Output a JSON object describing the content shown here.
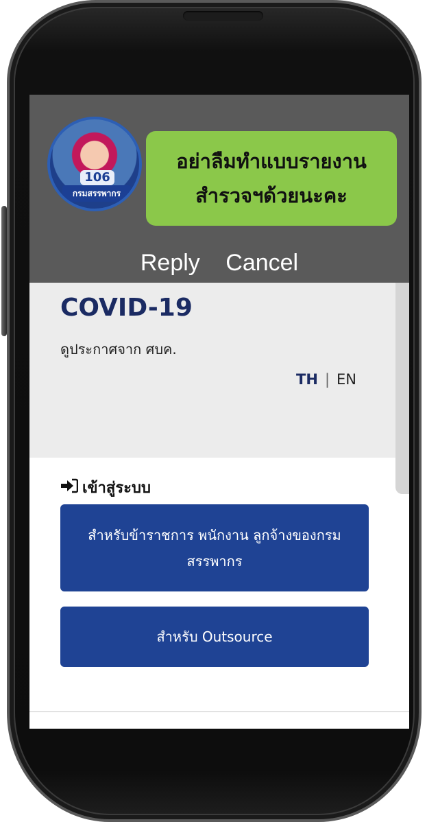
{
  "notification": {
    "message_line1": "อย่าลืมทำแบบรายงาน",
    "message_line2": "สำรวจฯด้วยนะคะ",
    "avatar_badge": "กรมสรรพากร",
    "avatar_number": "106",
    "reply_label": "Reply",
    "cancel_label": "Cancel",
    "bubble_color": "#8bc84a"
  },
  "hero": {
    "title": "COVID-19",
    "subtitle": "ดูประกาศจาก ศบค.",
    "lang_th": "TH",
    "lang_separator": "|",
    "lang_en": "EN"
  },
  "login": {
    "heading": "เข้าสู่ระบบ",
    "icon": "sign-in-icon",
    "staff_button": "สำหรับข้าราชการ พนักงาน ลูกจ้างของกรมสรรพากร",
    "outsource_button": "สำหรับ Outsource",
    "button_color": "#1f4394"
  }
}
